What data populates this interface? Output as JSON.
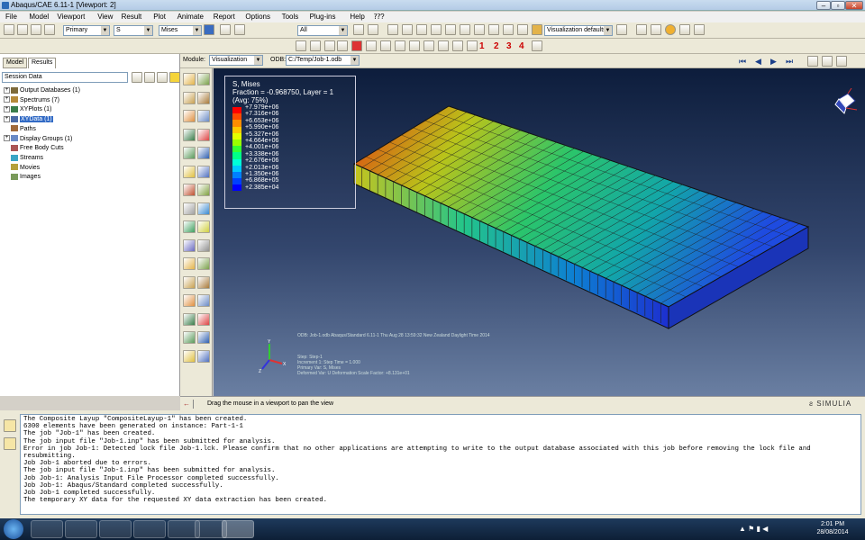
{
  "window": {
    "title": "Abaqus/CAE 6.11-1 [Viewport: 2]"
  },
  "menu": [
    "File",
    "Model",
    "Viewport",
    "View",
    "Result",
    "Plot",
    "Animate",
    "Report",
    "Options",
    "Tools",
    "Plug-ins",
    "Help",
    "⁇?"
  ],
  "toolbar": {
    "step_select": "Primary",
    "var_select": "S",
    "invariant_select": "Mises",
    "all_select": "All",
    "vis_defaults": "Visualization defaults"
  },
  "toolbar2": {
    "nums": [
      "1",
      "2",
      "3",
      "4"
    ]
  },
  "left": {
    "tabs": [
      "Model",
      "Results"
    ],
    "session": "Session Data",
    "tree": [
      {
        "label": "Output Databases (1)",
        "expand": "+",
        "color": "#7d6a3a"
      },
      {
        "label": "Spectrums (7)",
        "expand": "+",
        "color": "#b58a3a"
      },
      {
        "label": "XYPlots (1)",
        "expand": "+",
        "color": "#3a7d4a"
      },
      {
        "label": "XYData (1)",
        "expand": "+",
        "color": "#4a6aa5",
        "hl": true
      },
      {
        "label": "Paths",
        "expand": "",
        "color": "#a06a3a"
      },
      {
        "label": "Display Groups (1)",
        "expand": "+",
        "color": "#6a8ac5"
      },
      {
        "label": "Free Body Cuts",
        "expand": "",
        "color": "#a55"
      },
      {
        "label": "Streams",
        "expand": "",
        "color": "#3aa5c5"
      },
      {
        "label": "Movies",
        "expand": "",
        "color": "#b5a03a"
      },
      {
        "label": "Images",
        "expand": "",
        "color": "#7a9a5a"
      }
    ]
  },
  "context": {
    "module_label": "Module:",
    "module": "Visualization",
    "odb_label": "ODB:",
    "odb": "C:/Temp/Job-1.odb"
  },
  "legend": {
    "title": "S, Mises",
    "sub1": "Fraction = -0.968750, Layer = 1",
    "sub2": "(Avg: 75%)",
    "values": [
      "+7.979e+06",
      "+7.316e+06",
      "+6.653e+06",
      "+5.990e+06",
      "+5.327e+06",
      "+4.664e+06",
      "+4.001e+06",
      "+3.338e+06",
      "+2.676e+06",
      "+2.013e+06",
      "+1.350e+06",
      "+6.868e+05",
      "+2.385e+04"
    ],
    "colors": [
      "#ff0000",
      "#ff4a00",
      "#ff8c00",
      "#ffc800",
      "#e4ff00",
      "#9aff00",
      "#33ff33",
      "#00ff88",
      "#00ffd8",
      "#00c8ff",
      "#0080ff",
      "#0040ff",
      "#0000ff"
    ]
  },
  "viewport": {
    "odb_line": "ODB: Job-1.odb    Abaqus/Standard 6.11-1    Thu Aug 28 13:59:32 New Zealand Daylight Time 2014",
    "step_lines": [
      "Step: Step-1",
      "Increment      1: Step Time =    1.000",
      "Primary Var: S, Mises",
      "Deformed Var: U   Deformation Scale Factor: +8.131e+01"
    ]
  },
  "status": {
    "hint": "Drag the mouse in a viewport to pan the view",
    "brand": "SIMULIA"
  },
  "messages": [
    "The Composite Layup \"CompositeLayup-1\" has been created.",
    "6300 elements have been generated on instance: Part-1-1",
    "The job \"Job-1\" has been created.",
    "The job input file \"Job-1.inp\" has been submitted for analysis.",
    "Error in job Job-1: Detected lock file Job-1.lck. Please confirm that no other applications are attempting to write to the output database associated with this job before removing the lock file and",
    "resubmitting.",
    "Job Job-1 aborted due to errors.",
    "The job input file \"Job-1.inp\" has been submitted for analysis.",
    "Job Job-1: Analysis Input File Processor completed successfully.",
    "Job Job-1: Abaqus/Standard completed successfully.",
    "Job Job-1 completed successfully.",
    "The temporary XY data for the requested XY data extraction has been created."
  ],
  "taskbar": {
    "time": "2:01 PM",
    "date": "28/08/2014"
  }
}
